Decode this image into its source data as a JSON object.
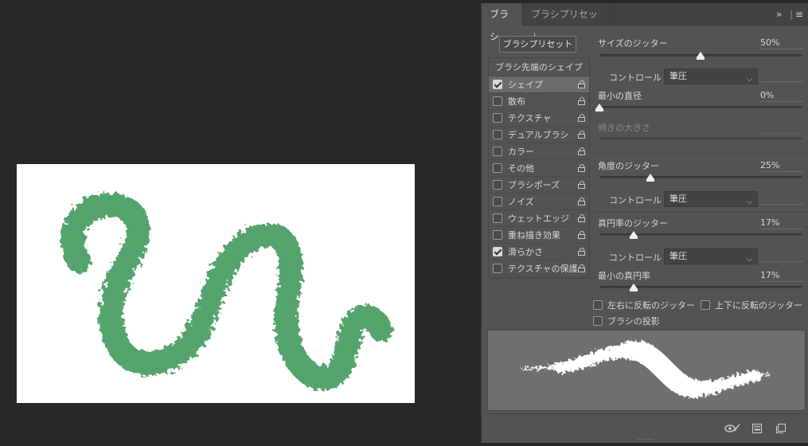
{
  "panel": {
    "tabs": [
      {
        "label": "ブラシ",
        "active": true
      },
      {
        "label": "ブラシプリセット",
        "active": false
      }
    ],
    "header_icons": [
      "collapse-arrows-icon",
      "panel-menu-icon"
    ],
    "preset_button": "ブラシプリセット",
    "list_header": "ブラシ先端のシェイプ",
    "items": [
      {
        "label": "シェイプ",
        "checked": true,
        "selected": true
      },
      {
        "label": "散布",
        "checked": false
      },
      {
        "label": "テクスチャ",
        "checked": false
      },
      {
        "label": "デュアルブラシ",
        "checked": false
      },
      {
        "label": "カラー",
        "checked": false
      },
      {
        "label": "その他",
        "checked": false
      },
      {
        "label": "ブラシポーズ",
        "checked": false
      },
      {
        "label": "ノイズ",
        "checked": false
      },
      {
        "label": "ウェットエッジ",
        "checked": false
      },
      {
        "label": "重ね描き効果",
        "checked": false
      },
      {
        "label": "滑らかさ",
        "checked": true
      },
      {
        "label": "テクスチャの保護",
        "checked": false
      }
    ],
    "controls": {
      "size_jitter": {
        "label": "サイズのジッター",
        "value": "50%",
        "level": 0.5
      },
      "size_control": {
        "label": "コントロール :",
        "value": "筆圧"
      },
      "min_diameter": {
        "label": "最小の直径",
        "value": "0%",
        "level": 0.0
      },
      "tilt_scale": {
        "label": "傾きの大きさ",
        "value": "",
        "disabled": true
      },
      "angle_jitter": {
        "label": "角度のジッター",
        "value": "25%",
        "level": 0.25
      },
      "angle_control": {
        "label": "コントロール :",
        "value": "筆圧"
      },
      "roundness_jitter": {
        "label": "真円率のジッター",
        "value": "17%",
        "level": 0.17
      },
      "roundness_control": {
        "label": "コントロール :",
        "value": "筆圧"
      },
      "min_roundness": {
        "label": "最小の真円率",
        "value": "17%",
        "level": 0.17
      }
    },
    "options": {
      "flip_x": {
        "label": "左右に反転のジッター",
        "checked": false
      },
      "flip_y": {
        "label": "上下に反転のジッター",
        "checked": false
      },
      "projection": {
        "label": "ブラシの投影",
        "checked": false
      }
    },
    "footer_icons": [
      "eye-toggle-icon",
      "grid-icon",
      "new-preset-icon"
    ]
  },
  "colors": {
    "brush_stroke": "#55a46e",
    "panel_bg": "#535353",
    "workspace_bg": "#282828",
    "preview_bg": "#6f6f6f"
  }
}
